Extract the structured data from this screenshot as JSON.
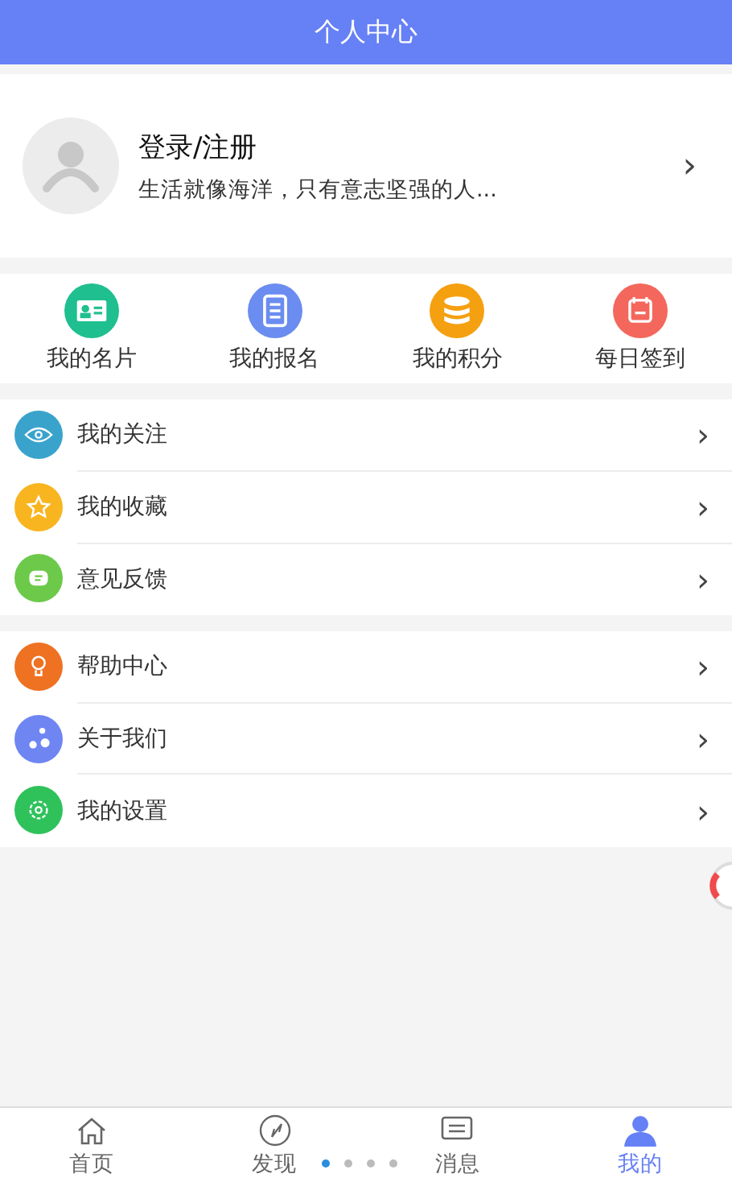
{
  "header": {
    "title": "个人中心"
  },
  "profile": {
    "name": "登录/注册",
    "motto": "生活就像海洋，只有意志坚强的人...",
    "chevron": "›"
  },
  "shortcuts": [
    {
      "label": "我的名片",
      "color": "#1fbf8f"
    },
    {
      "label": "我的报名",
      "color": "#6b8cf0"
    },
    {
      "label": "我的积分",
      "color": "#f5a010"
    },
    {
      "label": "每日签到",
      "color": "#f4675c"
    }
  ],
  "menu_groups": [
    [
      {
        "label": "我的关注",
        "color": "#3aa3cc",
        "chevron": "›"
      },
      {
        "label": "我的收藏",
        "color": "#f8b51f",
        "chevron": "›"
      },
      {
        "label": "意见反馈",
        "color": "#6cc94a",
        "chevron": "›"
      }
    ],
    [
      {
        "label": "帮助中心",
        "color": "#ee7222",
        "chevron": "›"
      },
      {
        "label": "关于我们",
        "color": "#6f86f2",
        "chevron": "›"
      },
      {
        "label": "我的设置",
        "color": "#2fc25b",
        "chevron": "›"
      }
    ]
  ],
  "tabs": [
    {
      "label": "首页",
      "selected": false
    },
    {
      "label": "发现",
      "selected": false
    },
    {
      "label": "消息",
      "selected": false
    },
    {
      "label": "我的",
      "selected": true
    }
  ],
  "page_dots": [
    {
      "selected": true
    },
    {
      "selected": false
    },
    {
      "selected": false
    },
    {
      "selected": false
    }
  ]
}
